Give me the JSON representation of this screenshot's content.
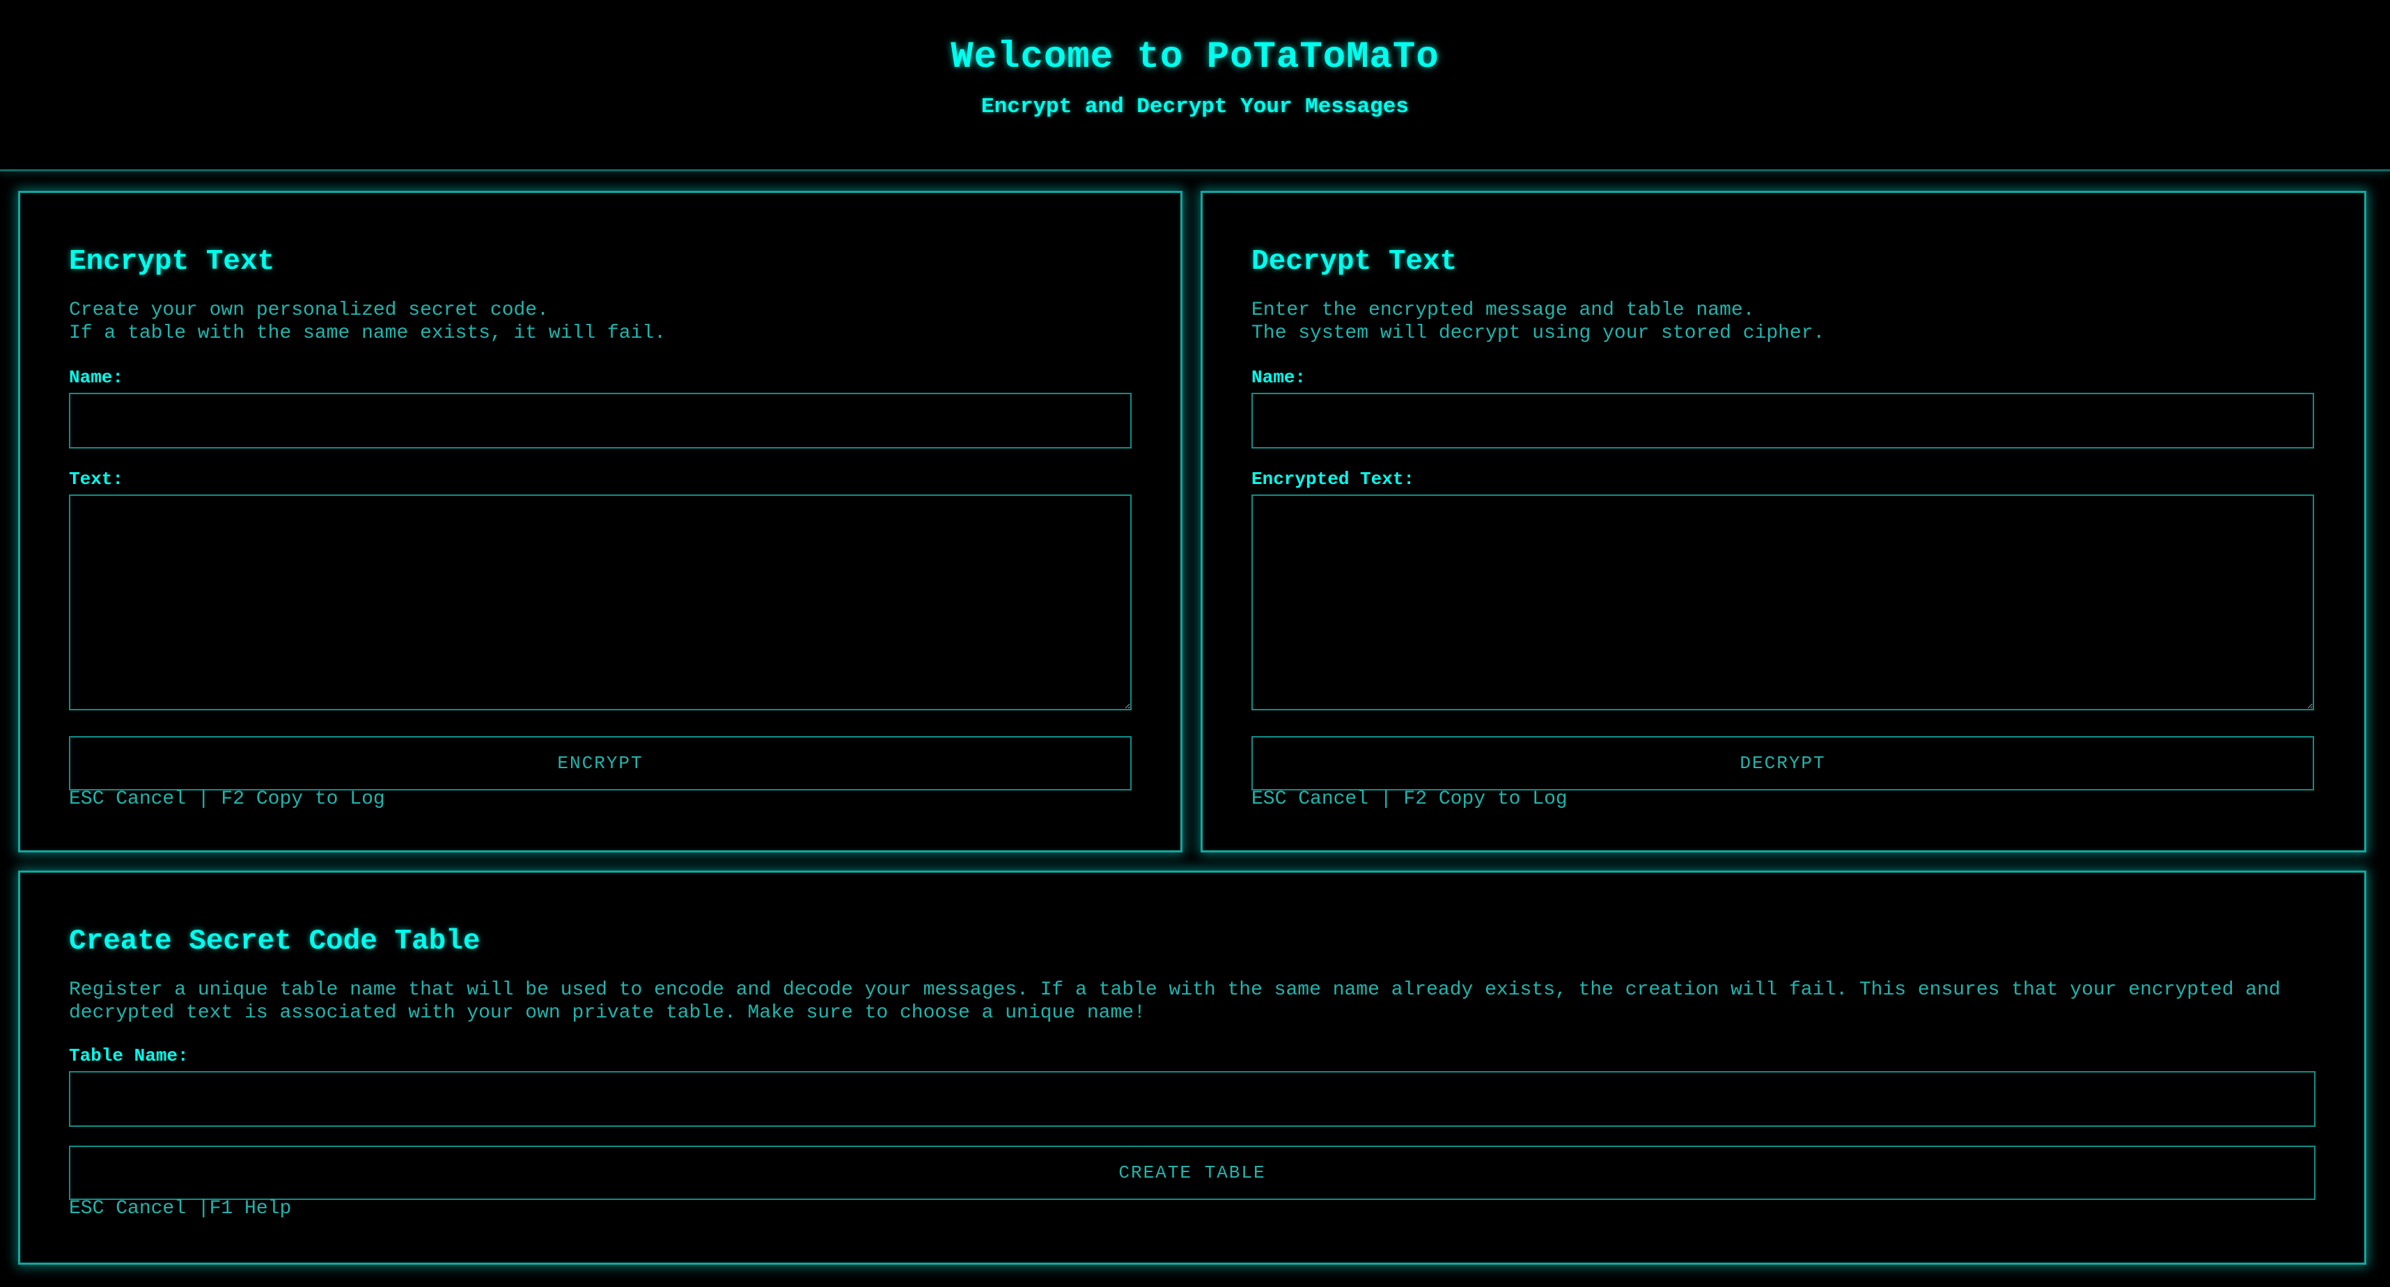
{
  "header": {
    "title": "Welcome to PoTaToMaTo",
    "subtitle": "Encrypt and Decrypt Your Messages"
  },
  "encrypt": {
    "title": "Encrypt Text",
    "description": "Create your own personalized secret code.\nIf a table with the same name exists, it will fail.",
    "name_label": "Name:",
    "name_value": "",
    "text_label": "Text:",
    "text_value": "",
    "button_label": "ENCRYPT",
    "hint": "ESC Cancel | F2 Copy to Log"
  },
  "decrypt": {
    "title": "Decrypt Text",
    "description": "Enter the encrypted message and table name.\nThe system will decrypt using your stored cipher.",
    "name_label": "Name:",
    "name_value": "",
    "text_label": "Encrypted Text:",
    "text_value": "",
    "button_label": "DECRYPT",
    "hint": "ESC Cancel | F2 Copy to Log"
  },
  "create_table": {
    "title": "Create Secret Code Table",
    "description": "Register a unique table name that will be used to encode and decode your messages. If a table with the same name already exists, the creation will fail. This ensures that your encrypted and decrypted text is associated with your own private table. Make sure to choose a unique name!",
    "table_name_label": "Table Name:",
    "table_name_value": "",
    "button_label": "CREATE TABLE",
    "hint": "ESC Cancel |F1 Help"
  },
  "theme": {
    "background": "#000000",
    "accent": "#00ffee",
    "text": "#1fb5ad",
    "border": "#11a8a0"
  }
}
